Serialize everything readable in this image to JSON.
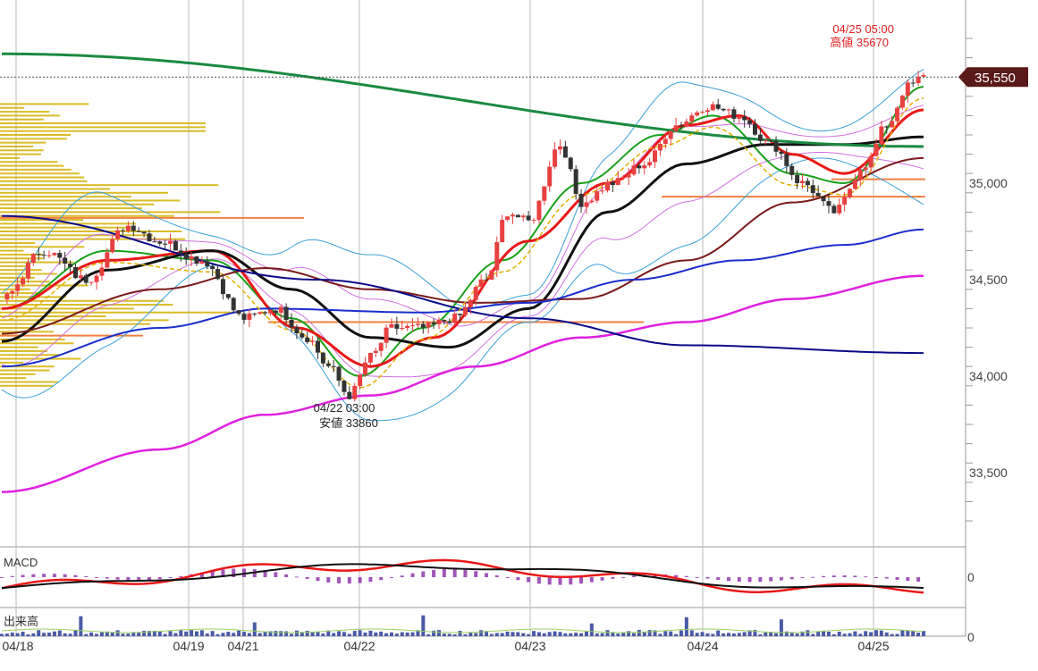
{
  "chart_data": {
    "type": "candlestick",
    "price_axis": {
      "ylim": [
        33100,
        35800
      ],
      "ticks": [
        33500,
        34000,
        34500,
        35000,
        35550
      ],
      "tick_labels": [
        "33,500",
        "34,000",
        "34,500",
        "35,000",
        "35,550"
      ]
    },
    "x_labels": [
      "04/18",
      "04/19",
      "04/21",
      "04/22",
      "04/23",
      "04/24",
      "04/25"
    ],
    "current_price_label": "35,550",
    "high_annotation": {
      "time": "04/25 05:00",
      "label": "高値 35670",
      "value": 35670
    },
    "low_annotation": {
      "time": "04/22 03:00",
      "label": "安値 33860",
      "value": 33860
    },
    "macd_panel": {
      "title": "MACD",
      "zero_label": "0"
    },
    "volume_panel": {
      "title": "出来高",
      "zero_label": "0"
    },
    "close_path": [
      [
        0,
        34400
      ],
      [
        8,
        34650
      ],
      [
        16,
        34500
      ],
      [
        24,
        34780
      ],
      [
        30,
        34700
      ],
      [
        38,
        34600
      ],
      [
        46,
        34300
      ],
      [
        52,
        34350
      ],
      [
        58,
        34200
      ],
      [
        62,
        34050
      ],
      [
        66,
        33900
      ],
      [
        70,
        34100
      ],
      [
        74,
        34250
      ],
      [
        80,
        34250
      ],
      [
        86,
        34300
      ],
      [
        92,
        34500
      ],
      [
        96,
        34850
      ],
      [
        100,
        34800
      ],
      [
        106,
        35200
      ],
      [
        110,
        34900
      ],
      [
        116,
        35000
      ],
      [
        122,
        35100
      ],
      [
        128,
        35300
      ],
      [
        134,
        35400
      ],
      [
        140,
        35350
      ],
      [
        146,
        35200
      ],
      [
        152,
        35000
      ],
      [
        158,
        34850
      ],
      [
        164,
        35100
      ],
      [
        168,
        35300
      ],
      [
        172,
        35500
      ],
      [
        175,
        35550
      ]
    ],
    "series": [
      {
        "color": "#19a019",
        "values": [
          [
            0,
            34350
          ],
          [
            20,
            34650
          ],
          [
            40,
            34600
          ],
          [
            55,
            34300
          ],
          [
            68,
            34000
          ],
          [
            80,
            34250
          ],
          [
            95,
            34600
          ],
          [
            110,
            35000
          ],
          [
            125,
            35250
          ],
          [
            135,
            35350
          ],
          [
            150,
            35050
          ],
          [
            160,
            35000
          ],
          [
            175,
            35500
          ]
        ]
      },
      {
        "color": "#e81818",
        "values": [
          [
            0,
            34350
          ],
          [
            20,
            34600
          ],
          [
            40,
            34650
          ],
          [
            56,
            34250
          ],
          [
            70,
            34050
          ],
          [
            82,
            34200
          ],
          [
            100,
            34700
          ],
          [
            115,
            35000
          ],
          [
            130,
            35300
          ],
          [
            140,
            35350
          ],
          [
            150,
            35150
          ],
          [
            160,
            35050
          ],
          [
            175,
            35380
          ]
        ]
      },
      {
        "color": "#111111",
        "values": [
          [
            0,
            34180
          ],
          [
            20,
            34550
          ],
          [
            40,
            34650
          ],
          [
            55,
            34450
          ],
          [
            70,
            34200
          ],
          [
            85,
            34150
          ],
          [
            100,
            34350
          ],
          [
            115,
            34850
          ],
          [
            130,
            35100
          ],
          [
            145,
            35200
          ],
          [
            160,
            35200
          ],
          [
            175,
            35240
          ]
        ]
      },
      {
        "color": "#7a1a1a",
        "values": [
          [
            0,
            34220
          ],
          [
            30,
            34450
          ],
          [
            50,
            34560
          ],
          [
            70,
            34450
          ],
          [
            90,
            34380
          ],
          [
            110,
            34400
          ],
          [
            130,
            34600
          ],
          [
            150,
            34900
          ],
          [
            175,
            35130
          ]
        ]
      },
      {
        "color": "#1a2ecc",
        "values": [
          [
            0,
            34050
          ],
          [
            30,
            34250
          ],
          [
            50,
            34350
          ],
          [
            80,
            34330
          ],
          [
            100,
            34380
          ],
          [
            120,
            34500
          ],
          [
            140,
            34600
          ],
          [
            160,
            34680
          ],
          [
            175,
            34760
          ]
        ]
      },
      {
        "color": "#e020e0",
        "values": [
          [
            0,
            33400
          ],
          [
            30,
            33620
          ],
          [
            50,
            33800
          ],
          [
            70,
            33900
          ],
          [
            90,
            34050
          ],
          [
            110,
            34200
          ],
          [
            130,
            34280
          ],
          [
            150,
            34400
          ],
          [
            175,
            34520
          ]
        ]
      },
      {
        "color": "#1a8a40",
        "values": [
          [
            0,
            35670
          ],
          [
            175,
            35190
          ]
        ]
      },
      {
        "color": "#0a0a8a",
        "values": [
          [
            0,
            34830
          ],
          [
            60,
            34500
          ],
          [
            100,
            34300
          ],
          [
            130,
            34160
          ],
          [
            175,
            34120
          ]
        ]
      }
    ]
  }
}
